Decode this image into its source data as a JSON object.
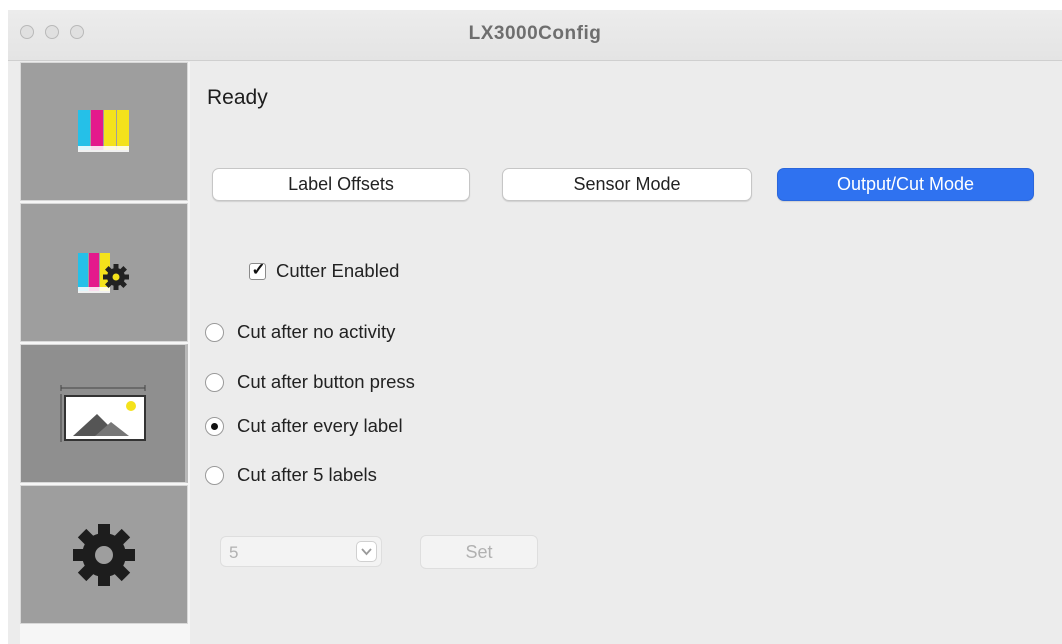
{
  "window": {
    "title": "LX3000Config"
  },
  "sidebar": {
    "items": [
      {
        "icon": "ink-bars-icon"
      },
      {
        "icon": "ink-settings-icon"
      },
      {
        "icon": "image-size-icon"
      },
      {
        "icon": "gear-icon"
      }
    ],
    "selected_index": 2
  },
  "status": "Ready",
  "tabs": [
    {
      "label": "Label Offsets",
      "active": false
    },
    {
      "label": "Sensor Mode",
      "active": false
    },
    {
      "label": "Output/Cut Mode",
      "active": true
    }
  ],
  "cutter": {
    "label": "Cutter Enabled",
    "checked": true
  },
  "cut_options": [
    {
      "label": "Cut after no activity",
      "selected": false
    },
    {
      "label": "Cut after button press",
      "selected": false
    },
    {
      "label": "Cut after every label",
      "selected": true
    },
    {
      "label": "Cut after 5 labels",
      "selected": false
    }
  ],
  "label_count": {
    "value": "5",
    "disabled": true
  },
  "set_button": {
    "label": "Set",
    "disabled": true
  },
  "colors": {
    "accent": "#2f72f0",
    "sidebar_tile": "#9e9e9e",
    "ink_cyan": "#25c0e8",
    "ink_magenta": "#e4198c",
    "ink_yellow": "#f4e21b"
  }
}
